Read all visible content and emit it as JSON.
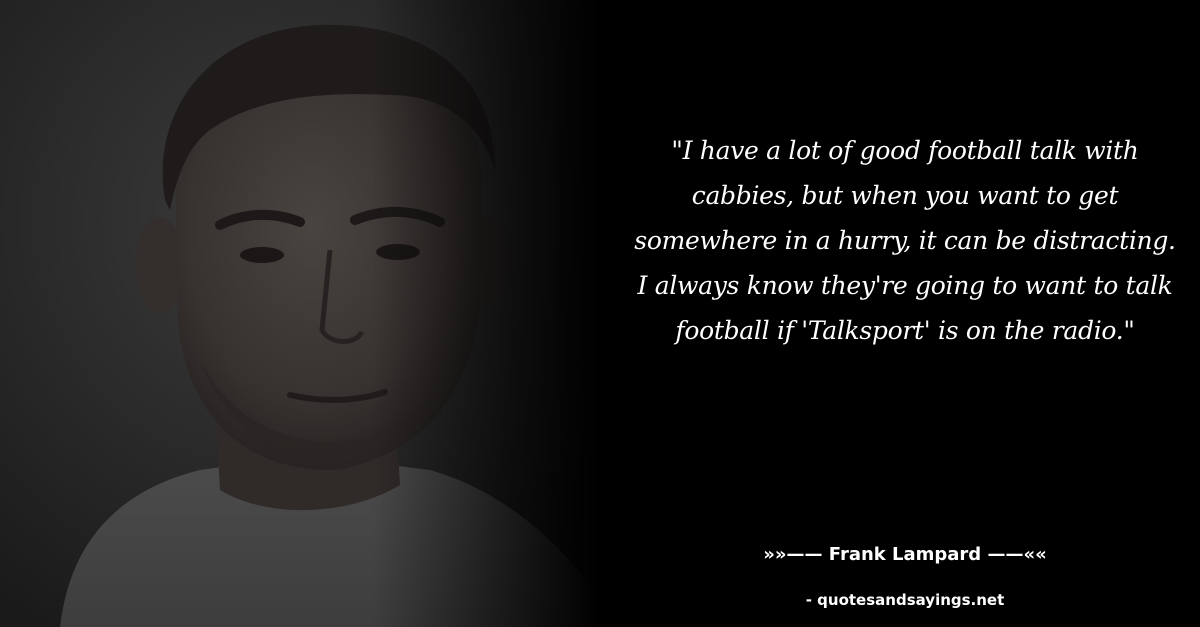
{
  "quote": {
    "text": "\"I have a lot of good football talk with cabbies, but when you want to get somewhere in a hurry, it can be distracting. I always know they're going to want to talk football if 'Talksport' is on the radio.\""
  },
  "author": {
    "line": "»»—— Frank Lampard ——««"
  },
  "source": {
    "label": "- quotesandsayings.net"
  },
  "colors": {
    "background": "#000000",
    "text": "#ffffff"
  }
}
